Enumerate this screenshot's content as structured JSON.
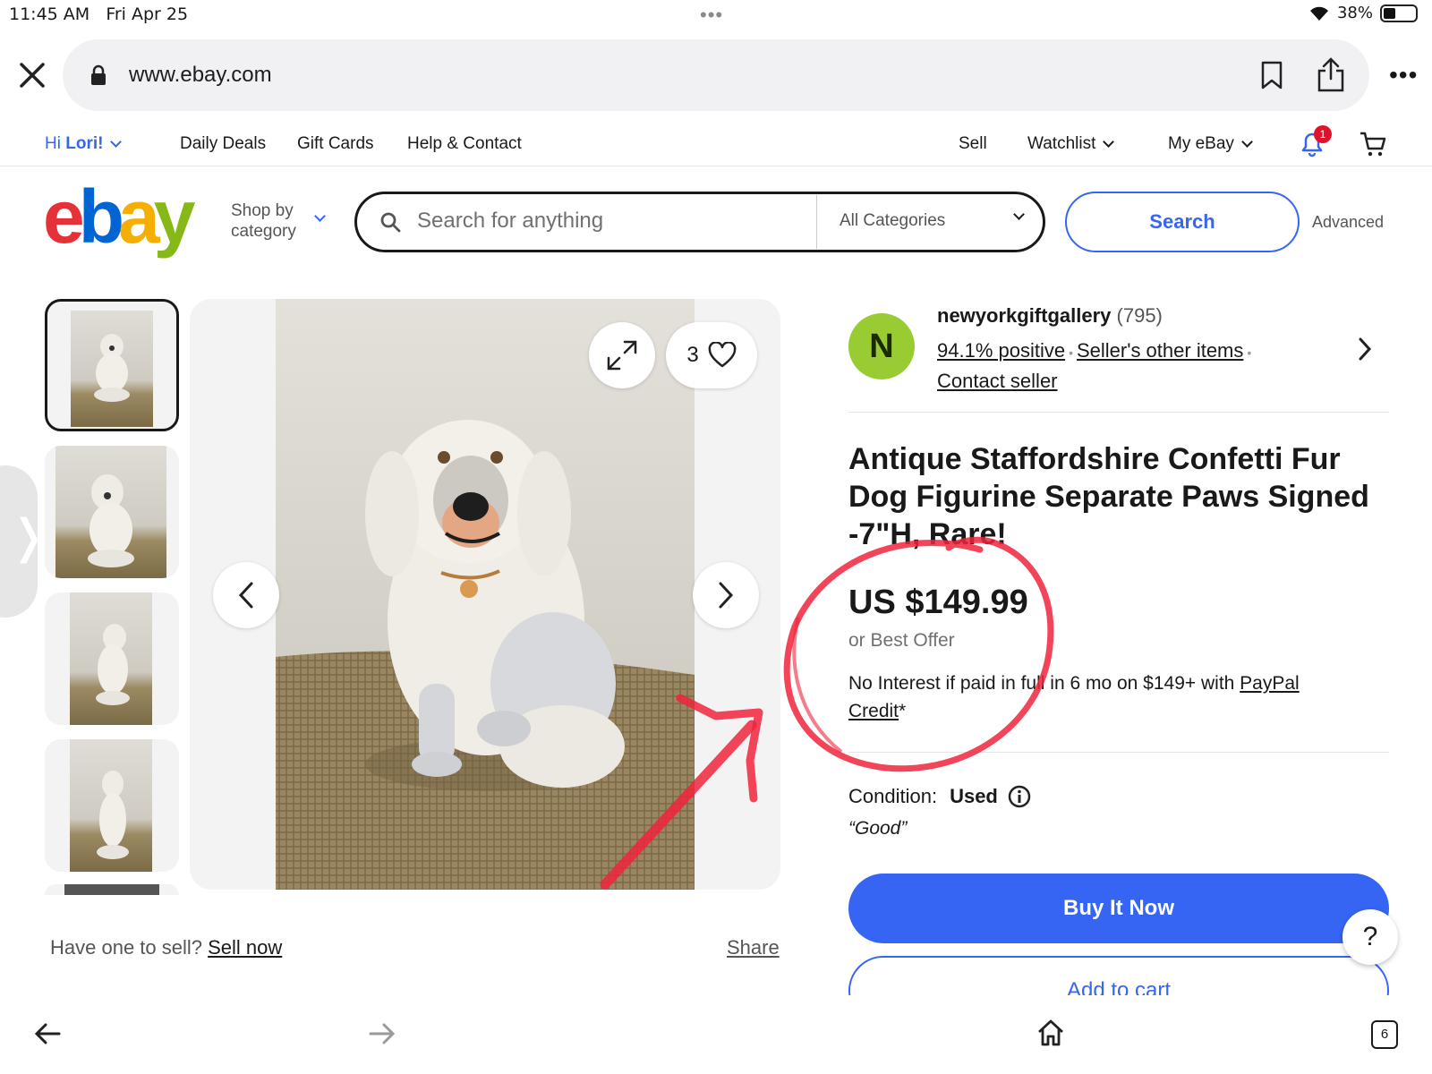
{
  "status": {
    "time": "11:45 AM",
    "date": "Fri Apr 25",
    "battery": "38%",
    "battery_level": 0.38
  },
  "browser": {
    "url": "www.ebay.com"
  },
  "topnav": {
    "greeting_prefix": "Hi ",
    "greeting_name": "Lori!",
    "daily_deals": "Daily Deals",
    "gift_cards": "Gift Cards",
    "help_contact": "Help & Contact",
    "sell": "Sell",
    "watchlist": "Watchlist",
    "my_ebay": "My eBay",
    "notification_count": "1"
  },
  "header": {
    "logo": {
      "e": "e",
      "b": "b",
      "a": "a",
      "y": "y"
    },
    "shop_by_line1": "Shop by",
    "shop_by_line2": "category",
    "search_placeholder": "Search for anything",
    "category": "All Categories",
    "search_button": "Search",
    "advanced": "Advanced"
  },
  "gallery": {
    "favorites_count": "3",
    "have_one": "Have one to sell?",
    "sell_now": "Sell now",
    "share": "Share"
  },
  "seller": {
    "initial": "N",
    "name": "newyorkgiftgallery",
    "feedback_count": "(795)",
    "positive": "94.1% positive",
    "other_items": "Seller's other items",
    "contact": "Contact seller"
  },
  "listing": {
    "title": "Antique Staffordshire Confetti Fur Dog Figurine Separate Paws Signed -7\"H, Rare!",
    "price": "US $149.99",
    "best_offer": "or Best Offer",
    "paypal_text": "No Interest if paid in full in 6 mo on $149+ with ",
    "paypal_link_1": "PayPal",
    "paypal_link_2": "Credit",
    "paypal_suffix": "*",
    "condition_label": "Condition:",
    "condition_value": "Used",
    "condition_note": "“Good”",
    "buy_now": "Buy It Now",
    "add_to_cart": "Add to cart",
    "help": "?"
  },
  "toolbar": {
    "tab_count": "6"
  },
  "colors": {
    "ebay_blue": "#3665f3",
    "annotation_red": "#f0253c",
    "avatar_green": "#99cc33"
  }
}
